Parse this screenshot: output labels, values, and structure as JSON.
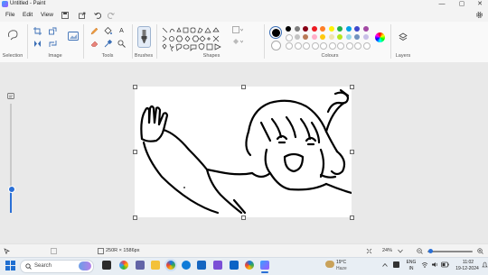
{
  "titlebar": {
    "title": "Untitled - Paint",
    "min": "—",
    "max": "▢",
    "close": "✕"
  },
  "menu": {
    "file": "File",
    "edit": "Edit",
    "view": "View"
  },
  "ribbon": {
    "groups": [
      "Selection",
      "Image",
      "Tools",
      "Brushes",
      "Shapes",
      "Colours",
      "Layers"
    ],
    "tools": {
      "text_tool": "A"
    },
    "colors_row1": [
      "#000000",
      "#7f7f7f",
      "#880015",
      "#ed1c24",
      "#ff7f27",
      "#fff200",
      "#22b14c",
      "#00a2e8",
      "#3f48cc",
      "#a349a4"
    ],
    "colors_row2": [
      "#ffffff",
      "#c3c3c3",
      "#b97a57",
      "#ffaec9",
      "#ffc90e",
      "#efe4b0",
      "#b5e61d",
      "#99d9ea",
      "#7092be",
      "#c8bfe7"
    ],
    "primary_color": "#000000",
    "secondary_color": "#ffffff"
  },
  "status": {
    "canvas_size": "250R × 1586px",
    "zoom": "24%"
  },
  "taskbar": {
    "search_placeholder": "Search",
    "weather_temp": "19°C",
    "weather_desc": "Haze",
    "lang_top": "ENG",
    "lang_bottom": "IN",
    "time": "11:02",
    "date": "19-12-2024"
  }
}
